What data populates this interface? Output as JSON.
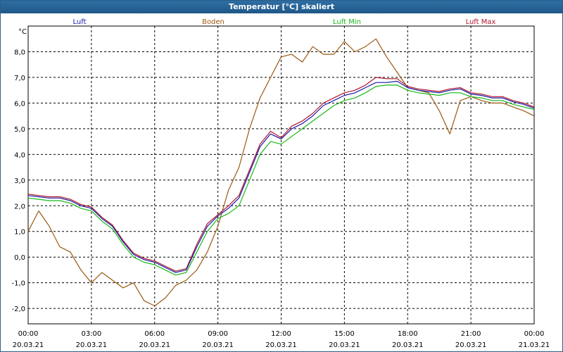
{
  "window": {
    "title": "Temperatur [°C] skaliert"
  },
  "colors": {
    "Luft": "#1a1aaa",
    "Boden": "#9a5a12",
    "Luft Min": "#16b816",
    "Luft Max": "#b0162a",
    "titlebar": "#2b6aa0",
    "grid": "#000000"
  },
  "chart_data": {
    "type": "line",
    "title": "Temperatur [°C] skaliert",
    "ylabel": "°C",
    "xlabel": "",
    "ylim": [
      -2.6,
      9.0
    ],
    "xlim_hours": [
      0,
      24
    ],
    "yticks": [
      -2.0,
      -1.0,
      0.0,
      1.0,
      2.0,
      3.0,
      4.0,
      5.0,
      6.0,
      7.0,
      8.0
    ],
    "ytick_labels": [
      "-2,0",
      "-1,0",
      "0,0",
      "1,0",
      "2,0",
      "3,0",
      "4,0",
      "5,0",
      "6,0",
      "7,0",
      "8,0"
    ],
    "xticks": [
      {
        "time": "00:00",
        "date": "20.03.21"
      },
      {
        "time": "03:00",
        "date": "20.03.21"
      },
      {
        "time": "06:00",
        "date": "20.03.21"
      },
      {
        "time": "09:00",
        "date": "20.03.21"
      },
      {
        "time": "12:00",
        "date": "20.03.21"
      },
      {
        "time": "15:00",
        "date": "20.03.21"
      },
      {
        "time": "18:00",
        "date": "20.03.21"
      },
      {
        "time": "21:00",
        "date": "20.03.21"
      },
      {
        "time": "00:00",
        "date": "21.03.21"
      }
    ],
    "grid": true,
    "legend_position": "top",
    "x_hours": [
      0,
      0.5,
      1,
      1.5,
      2,
      2.5,
      3,
      3.5,
      4,
      4.5,
      5,
      5.5,
      6,
      6.5,
      7,
      7.5,
      8,
      8.5,
      9,
      9.5,
      10,
      10.5,
      11,
      11.5,
      12,
      12.5,
      13,
      13.5,
      14,
      14.5,
      15,
      15.5,
      16,
      16.5,
      17,
      17.5,
      18,
      18.5,
      19,
      19.5,
      20,
      20.5,
      21,
      21.5,
      22,
      22.5,
      23,
      23.5,
      24
    ],
    "series": [
      {
        "name": "Luft",
        "values": [
          2.4,
          2.35,
          2.3,
          2.3,
          2.2,
          2.0,
          1.9,
          1.5,
          1.2,
          0.6,
          0.1,
          -0.1,
          -0.2,
          -0.4,
          -0.6,
          -0.5,
          0.4,
          1.2,
          1.6,
          1.9,
          2.3,
          3.3,
          4.3,
          4.8,
          4.6,
          5.0,
          5.2,
          5.5,
          5.9,
          6.1,
          6.3,
          6.4,
          6.6,
          6.8,
          6.8,
          6.85,
          6.6,
          6.5,
          6.45,
          6.4,
          6.5,
          6.55,
          6.35,
          6.3,
          6.2,
          6.2,
          6.05,
          5.95,
          5.8
        ]
      },
      {
        "name": "Boden",
        "values": [
          1.0,
          1.8,
          1.2,
          0.4,
          0.2,
          -0.5,
          -1.0,
          -0.6,
          -0.9,
          -1.2,
          -1.0,
          -1.7,
          -1.9,
          -1.6,
          -1.1,
          -0.9,
          -0.5,
          0.2,
          1.2,
          2.6,
          3.5,
          5.0,
          6.2,
          7.0,
          7.8,
          7.9,
          7.6,
          8.2,
          7.9,
          7.9,
          8.4,
          8.0,
          8.2,
          8.5,
          7.8,
          7.2,
          6.6,
          6.5,
          6.4,
          5.7,
          4.8,
          6.1,
          6.25,
          6.1,
          6.0,
          6.0,
          5.85,
          5.7,
          5.5
        ]
      },
      {
        "name": "Luft Min",
        "values": [
          2.3,
          2.25,
          2.2,
          2.2,
          2.1,
          1.9,
          1.8,
          1.4,
          1.1,
          0.5,
          0.0,
          -0.2,
          -0.3,
          -0.5,
          -0.7,
          -0.6,
          0.2,
          1.0,
          1.5,
          1.7,
          2.0,
          3.0,
          4.0,
          4.5,
          4.4,
          4.7,
          5.0,
          5.3,
          5.6,
          5.9,
          6.1,
          6.2,
          6.4,
          6.65,
          6.7,
          6.7,
          6.5,
          6.4,
          6.35,
          6.3,
          6.4,
          6.4,
          6.25,
          6.2,
          6.1,
          6.1,
          5.95,
          5.85,
          5.75
        ]
      },
      {
        "name": "Luft Max",
        "values": [
          2.45,
          2.4,
          2.35,
          2.35,
          2.25,
          2.05,
          1.95,
          1.55,
          1.25,
          0.65,
          0.15,
          -0.05,
          -0.15,
          -0.35,
          -0.55,
          -0.45,
          0.5,
          1.3,
          1.65,
          2.0,
          2.4,
          3.4,
          4.4,
          4.9,
          4.65,
          5.1,
          5.3,
          5.6,
          6.0,
          6.2,
          6.4,
          6.5,
          6.7,
          7.0,
          6.95,
          6.95,
          6.65,
          6.55,
          6.5,
          6.45,
          6.55,
          6.6,
          6.4,
          6.35,
          6.25,
          6.25,
          6.1,
          6.0,
          5.85
        ]
      }
    ]
  }
}
